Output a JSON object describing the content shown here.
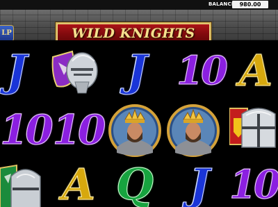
{
  "topbar": {
    "balance_label": "BALANCE",
    "balance_value": "980.00"
  },
  "header": {
    "title": "WILD KNIGHTS",
    "help_label": "LP"
  },
  "reels": {
    "row1": [
      "J",
      "shield-helmet",
      "J",
      "10",
      "A"
    ],
    "row2": [
      "10",
      "10",
      "king-portrait",
      "king-portrait",
      "crusader-helmet"
    ],
    "row3": [
      "green-shield-helmet",
      "A",
      "Q",
      "J",
      "10"
    ]
  },
  "symbols": {
    "J": "J",
    "ten": "10",
    "A": "A",
    "Q": "Q"
  },
  "colors": {
    "blue": "#1a35d8",
    "purple": "#8b1fe0",
    "gold": "#d7a80e",
    "green": "#17a33f",
    "title_red": "#a5121a",
    "title_gold": "#f6df8e"
  }
}
